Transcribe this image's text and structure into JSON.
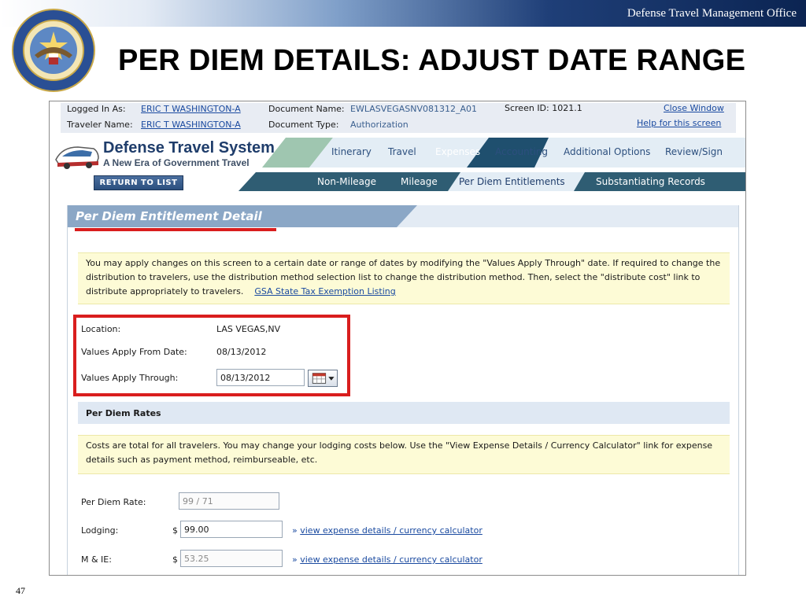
{
  "slide": {
    "org_name": "Defense Travel Management Office",
    "title": "PER DIEM DETAILS: ADJUST DATE RANGE",
    "page_number": "47"
  },
  "info_bar": {
    "logged_in_label": "Logged In As:",
    "logged_in_value": "ERIC T WASHINGTON-A",
    "traveler_label": "Traveler Name:",
    "traveler_value": "ERIC T WASHINGTON-A",
    "doc_name_label": "Document Name:",
    "doc_name_value": "EWLASVEGASNV081312_A01",
    "doc_type_label": "Document Type:",
    "doc_type_value": "Authorization",
    "screen_id": "Screen ID: 1021.1",
    "close_window": "Close Window",
    "help": "Help for this screen"
  },
  "logo": {
    "title": "Defense Travel System",
    "subtitle": "A New Era of Government Travel"
  },
  "return_button": "RETURN TO LIST",
  "main_tabs": [
    "Itinerary",
    "Travel",
    "Expenses",
    "Accounting",
    "Additional Options",
    "Review/Sign"
  ],
  "main_tab_active": "Expenses",
  "sub_tabs": [
    "Non-Mileage",
    "Mileage",
    "Per Diem Entitlements",
    "Substantiating Records"
  ],
  "sub_tab_active": "Per Diem Entitlements",
  "panel": {
    "title": "Per Diem Entitlement Detail",
    "instructions": "You may apply changes on this screen to a certain date or range of dates by modifying the \"Values Apply Through\" date. If required to change the distribution to travelers, use the distribution method selection list to change the distribution method. Then, select the \"distribute cost\" link to distribute appropriately to travelers.",
    "gsa_link": "GSA State Tax Exemption Listing"
  },
  "location": {
    "location_label": "Location:",
    "location_value": "LAS VEGAS,NV",
    "from_label": "Values Apply From Date:",
    "from_value": "08/13/2012",
    "through_label": "Values Apply Through:",
    "through_value": "08/13/2012"
  },
  "rates": {
    "header": "Per Diem Rates",
    "note": "Costs are total for all travelers. You may change your lodging costs below. Use the \"View Expense Details / Currency Calculator\" link for expense details such as payment method, reimburseable, etc.",
    "per_diem_label": "Per Diem Rate:",
    "per_diem_value": "99 / 71",
    "lodging_label": "Lodging:",
    "lodging_value": "99.00",
    "mie_label": "M & IE:",
    "mie_value": "53.25",
    "currency_symbol": "$",
    "calc_link": "view expense details / currency calculator",
    "link_marker": "»"
  },
  "colors": {
    "brand_navy": "#1f3d6b",
    "tab_teal": "#2f5d73",
    "highlight_red": "#d91e1e",
    "note_yellow": "#fdfbd6"
  }
}
